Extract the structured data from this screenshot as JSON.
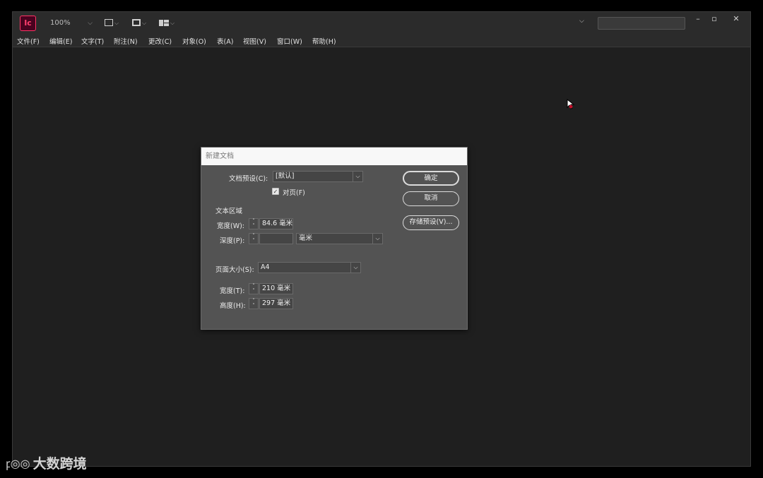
{
  "app": {
    "logo_text": "Ic",
    "zoom": "100%"
  },
  "menu": [
    "文件(F)",
    "编辑(E)",
    "文字(T)",
    "附注(N)",
    "更改(C)",
    "对象(O)",
    "表(A)",
    "视图(V)",
    "窗口(W)",
    "帮助(H)"
  ],
  "dialog": {
    "title": "新建文档",
    "preset_label": "文档预设(C):",
    "preset_value": "[默认]",
    "facing_pages_label": "对页(F)",
    "text_area_label": "文本区域",
    "width_label": "宽度(W):",
    "width_value": "84.6 毫米",
    "depth_label": "深度(P):",
    "depth_value": "",
    "depth_unit": "毫米",
    "page_size_label": "页面大小(S):",
    "page_size_value": "A4",
    "page_width_label": "宽度(T):",
    "page_width_value": "210 毫米",
    "page_height_label": "高度(H):",
    "page_height_value": "297 毫米",
    "ok_label": "确定",
    "cancel_label": "取消",
    "save_preset_label": "存储预设(V)..."
  },
  "watermark": {
    "text": "大数跨境"
  },
  "colors": {
    "workspace": "#1f1f1f",
    "chrome": "#2b2b2b",
    "dialog": "#535353",
    "brand": "#ff3366"
  }
}
